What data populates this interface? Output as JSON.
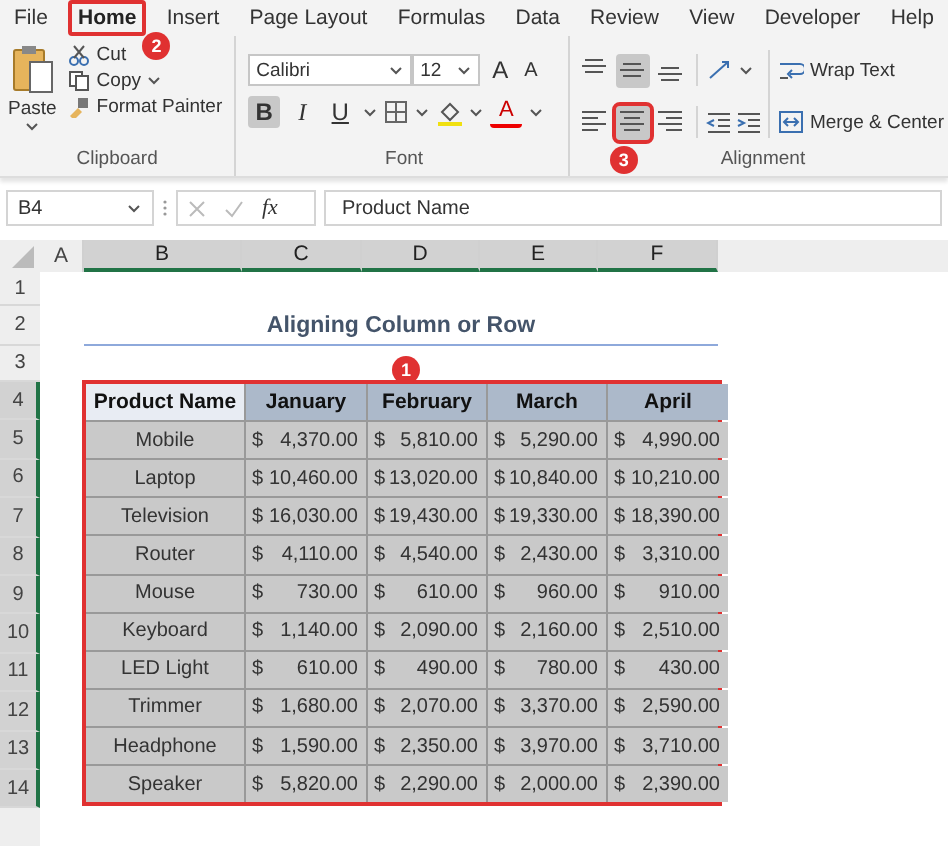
{
  "menu_tabs": [
    {
      "label": "File",
      "selected": false
    },
    {
      "label": "Home",
      "selected": true,
      "callout": "2"
    },
    {
      "label": "Insert",
      "selected": false
    },
    {
      "label": "Page Layout",
      "selected": false
    },
    {
      "label": "Formulas",
      "selected": false
    },
    {
      "label": "Data",
      "selected": false
    },
    {
      "label": "Review",
      "selected": false
    },
    {
      "label": "View",
      "selected": false
    },
    {
      "label": "Developer",
      "selected": false
    },
    {
      "label": "Help",
      "selected": false
    }
  ],
  "ribbon": {
    "clipboard": {
      "label": "Clipboard",
      "paste": "Paste",
      "cut": "Cut",
      "copy": "Copy",
      "format_painter": "Format Painter"
    },
    "font": {
      "label": "Font",
      "font_name": "Calibri",
      "font_size": "12",
      "grow": "A",
      "shrink": "A",
      "font_color": "A",
      "styles": [
        {
          "glyph": "B",
          "kind": "bold",
          "selected": true
        },
        {
          "glyph": "I",
          "kind": "italic",
          "selected": false
        },
        {
          "glyph": "U",
          "kind": "underline",
          "selected": false
        }
      ]
    },
    "alignment": {
      "label": "Alignment",
      "wrap_text": "Wrap Text",
      "merge_center": "Merge & Center",
      "vertical": [
        {
          "kind": "top",
          "selected": false
        },
        {
          "kind": "middle",
          "selected": true
        },
        {
          "kind": "bottom",
          "selected": false
        }
      ],
      "horizontal": [
        {
          "kind": "left",
          "selected": false
        },
        {
          "kind": "center",
          "selected": true,
          "callout": "3"
        },
        {
          "kind": "right",
          "selected": false
        }
      ]
    }
  },
  "formula_bar": {
    "name_box": "B4",
    "fx": "fx",
    "content": "Product Name"
  },
  "columns": [
    {
      "label": "A",
      "selected": false
    },
    {
      "label": "B",
      "selected": true
    },
    {
      "label": "C",
      "selected": true
    },
    {
      "label": "D",
      "selected": true
    },
    {
      "label": "E",
      "selected": true
    },
    {
      "label": "F",
      "selected": true
    }
  ],
  "rows": [
    {
      "label": "1",
      "selected": false
    },
    {
      "label": "2",
      "selected": false
    },
    {
      "label": "3",
      "selected": false
    },
    {
      "label": "4",
      "selected": true
    },
    {
      "label": "5",
      "selected": true
    },
    {
      "label": "6",
      "selected": true
    },
    {
      "label": "7",
      "selected": true
    },
    {
      "label": "8",
      "selected": true
    },
    {
      "label": "9",
      "selected": true
    },
    {
      "label": "10",
      "selected": true
    },
    {
      "label": "11",
      "selected": true
    },
    {
      "label": "12",
      "selected": true
    },
    {
      "label": "13",
      "selected": true
    },
    {
      "label": "14",
      "selected": true
    }
  ],
  "sheet_title": "Aligning Column or Row",
  "table": {
    "callout": "1",
    "columns": [
      "Product Name",
      "January",
      "February",
      "March",
      "April"
    ],
    "rows": [
      {
        "product": "Mobile",
        "values": [
          [
            "$",
            "4,370.00"
          ],
          [
            "$",
            "5,810.00"
          ],
          [
            "$",
            "5,290.00"
          ],
          [
            "$",
            "4,990.00"
          ]
        ]
      },
      {
        "product": "Laptop",
        "values": [
          [
            "$",
            "10,460.00"
          ],
          [
            "$",
            "13,020.00"
          ],
          [
            "$",
            "10,840.00"
          ],
          [
            "$",
            "10,210.00"
          ]
        ]
      },
      {
        "product": "Television",
        "values": [
          [
            "$",
            "16,030.00"
          ],
          [
            "$",
            "19,430.00"
          ],
          [
            "$",
            "19,330.00"
          ],
          [
            "$",
            "18,390.00"
          ]
        ]
      },
      {
        "product": "Router",
        "values": [
          [
            "$",
            "4,110.00"
          ],
          [
            "$",
            "4,540.00"
          ],
          [
            "$",
            "2,430.00"
          ],
          [
            "$",
            "3,310.00"
          ]
        ]
      },
      {
        "product": "Mouse",
        "values": [
          [
            "$",
            "730.00"
          ],
          [
            "$",
            "610.00"
          ],
          [
            "$",
            "960.00"
          ],
          [
            "$",
            "910.00"
          ]
        ]
      },
      {
        "product": "Keyboard",
        "values": [
          [
            "$",
            "1,140.00"
          ],
          [
            "$",
            "2,090.00"
          ],
          [
            "$",
            "2,160.00"
          ],
          [
            "$",
            "2,510.00"
          ]
        ]
      },
      {
        "product": "LED Light",
        "values": [
          [
            "$",
            "610.00"
          ],
          [
            "$",
            "490.00"
          ],
          [
            "$",
            "780.00"
          ],
          [
            "$",
            "430.00"
          ]
        ]
      },
      {
        "product": "Trimmer",
        "values": [
          [
            "$",
            "1,680.00"
          ],
          [
            "$",
            "2,070.00"
          ],
          [
            "$",
            "3,370.00"
          ],
          [
            "$",
            "2,590.00"
          ]
        ]
      },
      {
        "product": "Headphone",
        "values": [
          [
            "$",
            "1,590.00"
          ],
          [
            "$",
            "2,350.00"
          ],
          [
            "$",
            "3,970.00"
          ],
          [
            "$",
            "3,710.00"
          ]
        ]
      },
      {
        "product": "Speaker",
        "values": [
          [
            "$",
            "5,820.00"
          ],
          [
            "$",
            "2,290.00"
          ],
          [
            "$",
            "2,000.00"
          ],
          [
            "$",
            "2,390.00"
          ]
        ]
      }
    ]
  }
}
